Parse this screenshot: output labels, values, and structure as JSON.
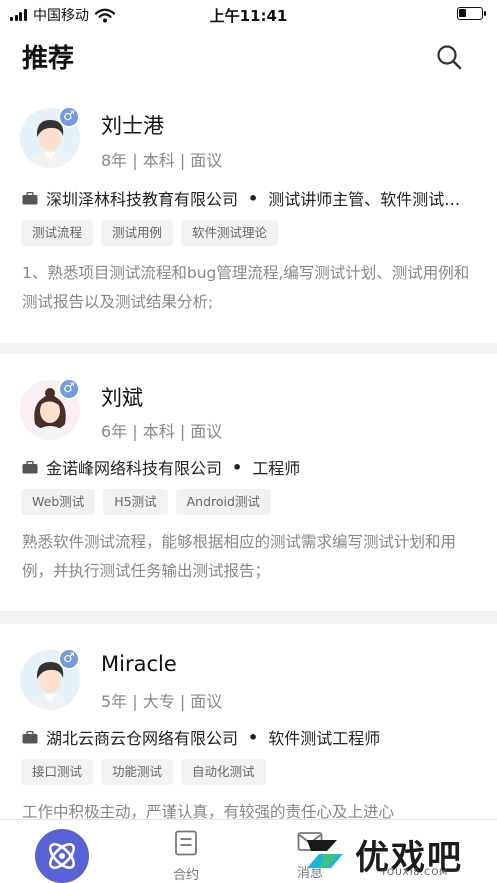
{
  "status_bar": {
    "carrier": "中国移动",
    "time": "上午11:41",
    "battery_level": 0.35
  },
  "header": {
    "title": "推荐",
    "search_icon": "search-icon"
  },
  "candidates": [
    {
      "name": "刘士港",
      "meta": "8年 | 本科 | 面议",
      "gender": "male",
      "avatar": "male-avatar",
      "company": "深圳泽林科技教育有限公司",
      "role": "测试讲师主管、软件测试工程师",
      "tags": [
        "测试流程",
        "测试用例",
        "软件测试理论"
      ],
      "description": "1、熟悉项目测试流程和bug管理流程,编写测试计划、测试用例和测试报告以及测试结果分析;"
    },
    {
      "name": "刘斌",
      "meta": "6年 | 本科 | 面议",
      "gender": "male",
      "avatar": "female-avatar",
      "company": "金诺峰网络科技有限公司",
      "role": "工程师",
      "tags": [
        "Web测试",
        "H5测试",
        "Android测试"
      ],
      "description": "熟悉软件测试流程，能够根据相应的测试需求编写测试计划和用例，并执行测试任务输出测试报告；"
    },
    {
      "name": "Miracle",
      "meta": "5年 | 大专 | 面议",
      "gender": "male",
      "avatar": "male-avatar",
      "company": "湖北云商云仓网络有限公司",
      "role": "软件测试工程师",
      "tags": [
        "接口测试",
        "功能测试",
        "自动化测试"
      ],
      "description": "工作中积极主动，严谨认真，有较强的责任心及上进心"
    }
  ],
  "tabbar": {
    "tabs": [
      {
        "label": "",
        "icon": "discover-icon",
        "active": true
      },
      {
        "label": "合约",
        "icon": "contract-icon",
        "active": false
      },
      {
        "label": "消息",
        "icon": "message-icon",
        "active": false
      }
    ]
  },
  "watermark": {
    "text": "优戏吧",
    "sub": "YOUXI8.COM"
  },
  "colors": {
    "accent": "#5662d6",
    "gender_badge": "#6f9de0",
    "tag_bg": "#f2f2f3"
  }
}
